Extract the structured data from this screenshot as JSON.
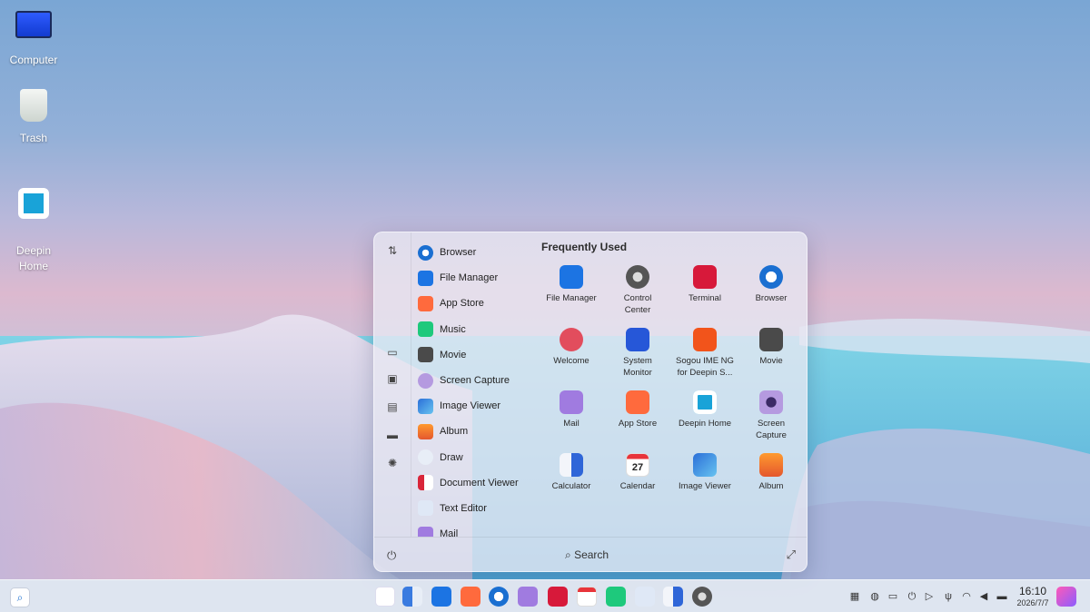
{
  "desktop": {
    "icons": [
      {
        "label": "Computer",
        "icon": "computer-icon"
      },
      {
        "label": "Trash",
        "icon": "trash-icon"
      },
      {
        "label": "Deepin\nHome",
        "icon": "deepin-home-icon"
      }
    ]
  },
  "launcher": {
    "frequently_used_title": "Frequently Used",
    "search_label": "Search",
    "app_list": [
      {
        "label": "Browser",
        "icon": "browser-icon"
      },
      {
        "label": "File Manager",
        "icon": "file-manager-icon"
      },
      {
        "label": "App Store",
        "icon": "app-store-icon"
      },
      {
        "label": "Music",
        "icon": "music-icon"
      },
      {
        "label": "Movie",
        "icon": "movie-icon"
      },
      {
        "label": "Screen Capture",
        "icon": "screen-capture-icon"
      },
      {
        "label": "Image Viewer",
        "icon": "image-viewer-icon"
      },
      {
        "label": "Album",
        "icon": "album-icon"
      },
      {
        "label": "Draw",
        "icon": "draw-icon"
      },
      {
        "label": "Document Viewer",
        "icon": "document-viewer-icon"
      },
      {
        "label": "Text Editor",
        "icon": "text-editor-icon"
      },
      {
        "label": "Mail",
        "icon": "mail-icon"
      }
    ],
    "frequent": [
      {
        "label": "File Manager",
        "icon": "file-manager-icon"
      },
      {
        "label": "Control\nCenter",
        "icon": "control-center-icon"
      },
      {
        "label": "Terminal",
        "icon": "terminal-icon"
      },
      {
        "label": "Browser",
        "icon": "browser-icon"
      },
      {
        "label": "Welcome",
        "icon": "welcome-icon"
      },
      {
        "label": "System\nMonitor",
        "icon": "system-monitor-icon"
      },
      {
        "label": "Sogou IME NG\nfor Deepin S...",
        "icon": "sogou-ime-icon"
      },
      {
        "label": "Movie",
        "icon": "movie-icon"
      },
      {
        "label": "Mail",
        "icon": "mail-icon"
      },
      {
        "label": "App Store",
        "icon": "app-store-icon"
      },
      {
        "label": "Deepin Home",
        "icon": "deepin-home-icon"
      },
      {
        "label": "Screen\nCapture",
        "icon": "screen-capture-icon"
      },
      {
        "label": "Calculator",
        "icon": "calculator-icon"
      },
      {
        "label": "Calendar",
        "icon": "calendar-icon"
      },
      {
        "label": "Image Viewer",
        "icon": "image-viewer-icon"
      },
      {
        "label": "Album",
        "icon": "album-icon"
      }
    ],
    "calendar_day": "27"
  },
  "taskbar": {
    "time": "16:10",
    "date": "2026/7/7",
    "dock": [
      "launcher-icon",
      "multitask-icon",
      "file-manager-icon",
      "app-store-icon",
      "browser-icon",
      "mail-icon",
      "terminal-icon",
      "calendar-icon",
      "music-icon",
      "text-editor-icon",
      "calculator-icon",
      "control-center-icon"
    ],
    "tray": [
      "keyboard-icon",
      "shield-icon",
      "battery-icon",
      "power-icon",
      "play-icon",
      "usb-icon",
      "wifi-icon",
      "volume-icon",
      "toggle-icon"
    ]
  },
  "colors": {
    "accent": "#1a6fd1"
  }
}
